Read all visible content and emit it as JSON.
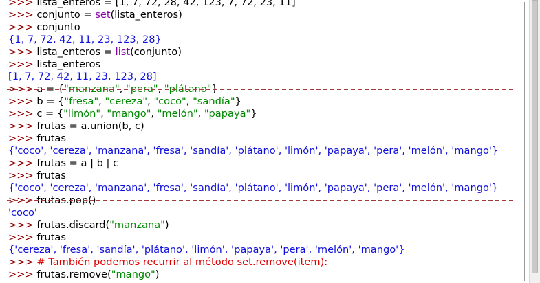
{
  "shell": {
    "lines": [
      {
        "prompt": ">>>",
        "segments": [
          {
            "t": "code",
            "text": " lista_enteros = [1, 7, 72, 28, 42, 123, 7, 72, 23, 11]"
          }
        ]
      },
      {
        "prompt": ">>>",
        "segments": [
          {
            "t": "code",
            "text": " conjunto = "
          },
          {
            "t": "builtin",
            "text": "set"
          },
          {
            "t": "code",
            "text": "(lista_enteros)"
          }
        ]
      },
      {
        "prompt": ">>>",
        "segments": [
          {
            "t": "code",
            "text": " conjunto"
          }
        ]
      },
      {
        "prompt": "",
        "segments": [
          {
            "t": "out",
            "text": "{1, 7, 72, 42, 11, 23, 123, 28}"
          }
        ]
      },
      {
        "prompt": ">>>",
        "segments": [
          {
            "t": "code",
            "text": " lista_enteros = "
          },
          {
            "t": "builtin",
            "text": "list"
          },
          {
            "t": "code",
            "text": "(conjunto)"
          }
        ]
      },
      {
        "prompt": ">>>",
        "segments": [
          {
            "t": "code",
            "text": " lista_enteros"
          }
        ]
      },
      {
        "prompt": "",
        "segments": [
          {
            "t": "out",
            "text": "[1, 7, 72, 42, 11, 23, 123, 28]"
          }
        ]
      },
      {
        "prompt": ">>>",
        "segments": [
          {
            "t": "code",
            "text": " a = {"
          },
          {
            "t": "str",
            "text": "\"manzana\""
          },
          {
            "t": "code",
            "text": ", "
          },
          {
            "t": "str",
            "text": "\"pera\""
          },
          {
            "t": "code",
            "text": ", "
          },
          {
            "t": "str",
            "text": "\"plátano\""
          },
          {
            "t": "code",
            "text": "}"
          }
        ]
      },
      {
        "prompt": ">>>",
        "segments": [
          {
            "t": "code",
            "text": " b = {"
          },
          {
            "t": "str",
            "text": "\"fresa\""
          },
          {
            "t": "code",
            "text": ", "
          },
          {
            "t": "str",
            "text": "\"cereza\""
          },
          {
            "t": "code",
            "text": ", "
          },
          {
            "t": "str",
            "text": "\"coco\""
          },
          {
            "t": "code",
            "text": ", "
          },
          {
            "t": "str",
            "text": "\"sandía\""
          },
          {
            "t": "code",
            "text": "}"
          }
        ]
      },
      {
        "prompt": ">>>",
        "segments": [
          {
            "t": "code",
            "text": " c = {"
          },
          {
            "t": "str",
            "text": "\"limón\""
          },
          {
            "t": "code",
            "text": ", "
          },
          {
            "t": "str",
            "text": "\"mango\""
          },
          {
            "t": "code",
            "text": ", "
          },
          {
            "t": "str",
            "text": "\"melón\""
          },
          {
            "t": "code",
            "text": ", "
          },
          {
            "t": "str",
            "text": "\"papaya\""
          },
          {
            "t": "code",
            "text": "}"
          }
        ]
      },
      {
        "prompt": ">>>",
        "segments": [
          {
            "t": "code",
            "text": " frutas = a.union(b, c)"
          }
        ]
      },
      {
        "prompt": ">>>",
        "segments": [
          {
            "t": "code",
            "text": " frutas"
          }
        ]
      },
      {
        "prompt": "",
        "segments": [
          {
            "t": "out",
            "text": "{'coco', 'cereza', 'manzana', 'fresa', 'sandía', 'plátano', 'limón', 'papaya', 'pera', 'melón', 'mango'}"
          }
        ]
      },
      {
        "prompt": ">>>",
        "segments": [
          {
            "t": "code",
            "text": " frutas = a | b | c"
          }
        ]
      },
      {
        "prompt": ">>>",
        "segments": [
          {
            "t": "code",
            "text": " frutas"
          }
        ]
      },
      {
        "prompt": "",
        "segments": [
          {
            "t": "out",
            "text": "{'coco', 'cereza', 'manzana', 'fresa', 'sandía', 'plátano', 'limón', 'papaya', 'pera', 'melón', 'mango'}"
          }
        ]
      },
      {
        "prompt": ">>>",
        "segments": [
          {
            "t": "code",
            "text": " frutas.pop()"
          }
        ]
      },
      {
        "prompt": "",
        "segments": [
          {
            "t": "out",
            "text": "'coco'"
          }
        ]
      },
      {
        "prompt": ">>>",
        "segments": [
          {
            "t": "code",
            "text": " frutas.discard("
          },
          {
            "t": "str",
            "text": "\"manzana\""
          },
          {
            "t": "code",
            "text": ")"
          }
        ]
      },
      {
        "prompt": ">>>",
        "segments": [
          {
            "t": "code",
            "text": " frutas"
          }
        ]
      },
      {
        "prompt": "",
        "segments": [
          {
            "t": "out",
            "text": "{'cereza', 'fresa', 'sandía', 'plátano', 'limón', 'papaya', 'pera', 'melón', 'mango'}"
          }
        ]
      },
      {
        "prompt": ">>>",
        "segments": [
          {
            "t": "comment",
            "text": " # También podemos recurrir al método set.remove(item):"
          }
        ]
      },
      {
        "prompt": ">>>",
        "segments": [
          {
            "t": "code",
            "text": " frutas.remove("
          },
          {
            "t": "str",
            "text": "\"mango\""
          },
          {
            "t": "code",
            "text": ")"
          }
        ]
      }
    ]
  },
  "colors": {
    "prompt": "#8b0000",
    "output": "#1111dd",
    "string": "#008800",
    "builtin": "#8800aa",
    "comment": "#dd0000",
    "annotation_dash": "#a33a3a"
  }
}
